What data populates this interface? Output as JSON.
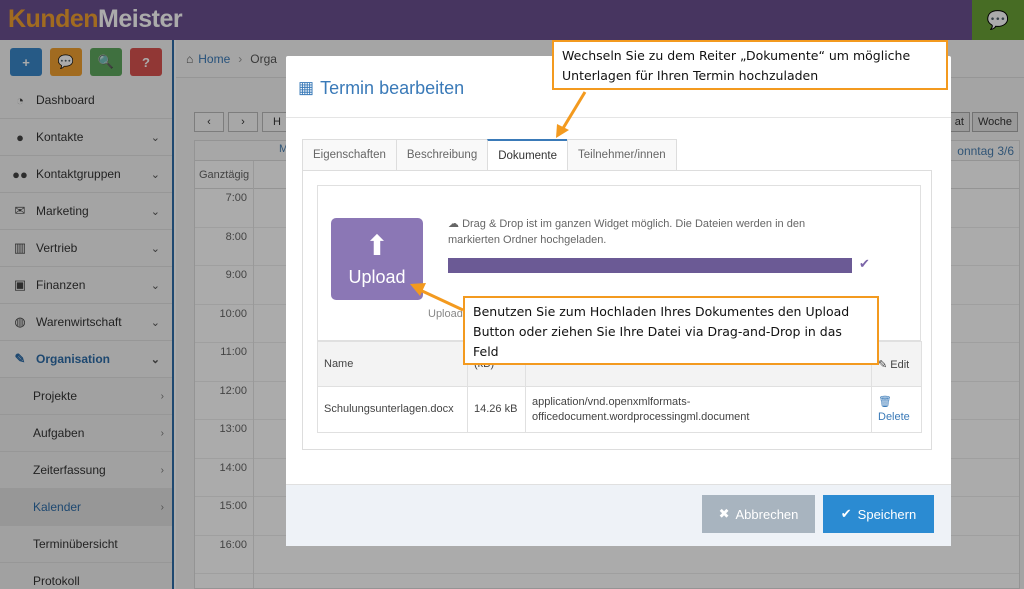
{
  "app": {
    "logo_part1": "Kunden",
    "logo_part2": "Meister"
  },
  "quick_buttons": [
    {
      "label": "+",
      "color": "#3a87c8"
    },
    {
      "label": "💬",
      "color": "#f0a030"
    },
    {
      "label": "🔍",
      "color": "#5fa85f"
    },
    {
      "label": "?",
      "color": "#d9534f"
    }
  ],
  "sidebar": {
    "items": [
      {
        "label": "Dashboard",
        "icon": "dashboard-icon"
      },
      {
        "label": "Kontakte",
        "icon": "user-icon"
      },
      {
        "label": "Kontaktgruppen",
        "icon": "users-icon"
      },
      {
        "label": "Marketing",
        "icon": "envelope-icon"
      },
      {
        "label": "Vertrieb",
        "icon": "chart-icon"
      },
      {
        "label": "Finanzen",
        "icon": "money-icon"
      },
      {
        "label": "Warenwirtschaft",
        "icon": "globe-icon"
      },
      {
        "label": "Organisation",
        "icon": "edit-icon"
      }
    ],
    "subitems": [
      "Projekte",
      "Aufgaben",
      "Zeiterfassung",
      "Kalender",
      "Terminübersicht",
      "Protokoll"
    ]
  },
  "breadcrumb": {
    "home": "Home",
    "current": "Orga"
  },
  "calendar": {
    "allday": "Ganztägig",
    "times": [
      "7:00",
      "8:00",
      "9:00",
      "10:00",
      "11:00",
      "12:00",
      "13:00",
      "14:00",
      "15:00",
      "16:00"
    ],
    "view_buttons": [
      "at",
      "Woche"
    ],
    "day_header": "onntag 3/6",
    "col_m": "M",
    "nav_h": "H"
  },
  "modal": {
    "title": "Termin bearbeiten",
    "tabs": [
      "Eigenschaften",
      "Beschreibung",
      "Dokumente",
      "Teilnehmer/innen"
    ],
    "upload_label": "Upload",
    "dropzone_info": "Drag & Drop ist im ganzen Widget möglich. Die Dateien werden in den markierten Ordner hochgeladen.",
    "upload_caption": "Upload",
    "table": {
      "headers": [
        "Name",
        "(kB)",
        "",
        "Edit"
      ],
      "rows": [
        {
          "name": "Schulungsunterlagen.docx",
          "size": "14.26 kB",
          "type": "application/vnd.openxmlformats-officedocument.wordprocessingml.document",
          "action": "Delete"
        }
      ]
    },
    "cancel": "Abbrechen",
    "save": "Speichern"
  },
  "callouts": {
    "tab_hint": "Wechseln Sie zu dem Reiter „Dokumente“ um mögliche Unterlagen für Ihren Termin hochzuladen",
    "upload_hint": "Benutzen Sie zum Hochladen Ihres Dokumentes  den Upload Button oder ziehen Sie Ihre Datei via Drag-and-Drop in das Feld"
  }
}
